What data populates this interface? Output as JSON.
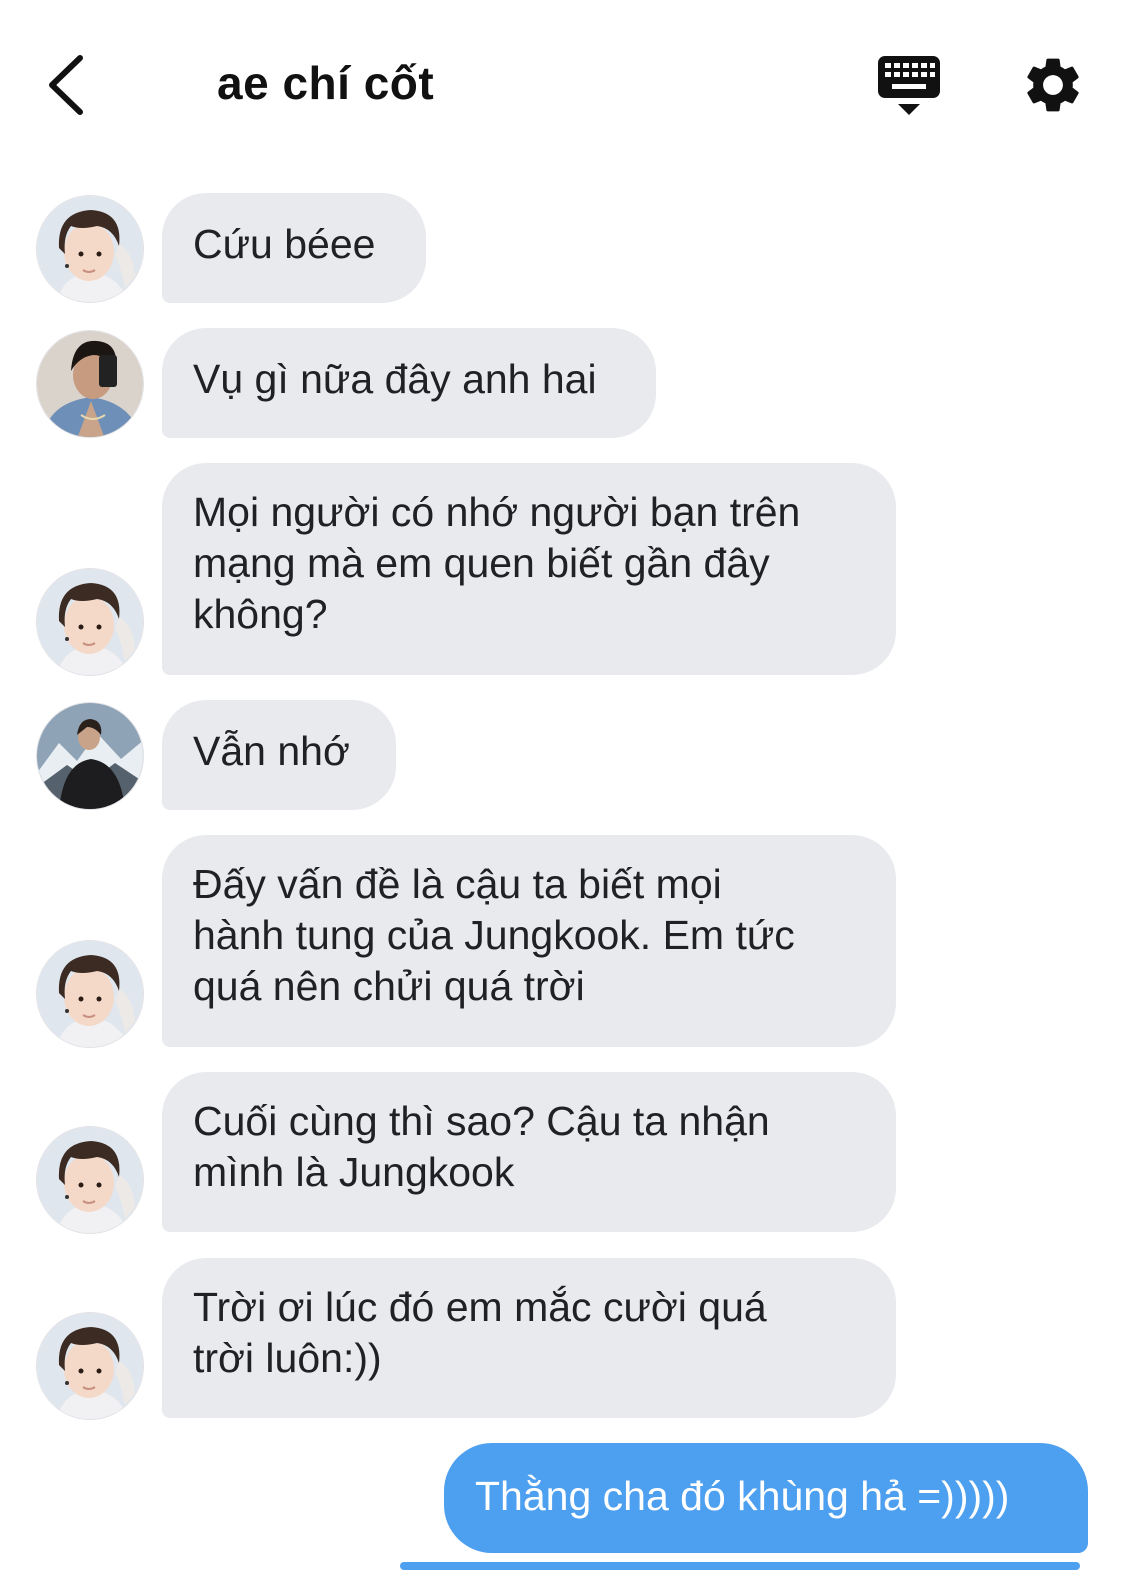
{
  "header": {
    "title": "ae chí cốt"
  },
  "icons": {
    "back": "chevron-left-icon",
    "keyboard": "keyboard-icon",
    "settings": "gear-icon"
  },
  "colors": {
    "incoming_bubble": "#e8eaee",
    "outgoing_bubble": "#4d9ff0",
    "outgoing_text": "#ffffff"
  },
  "messages": [
    {
      "sender": "jimin",
      "lines": [
        "Cứu béee"
      ]
    },
    {
      "sender": "taehyung",
      "lines": [
        "Vụ gì nữa đây anh hai"
      ]
    },
    {
      "sender": "jimin",
      "lines": [
        "Mọi người có nhớ người bạn trên",
        "mạng mà em quen biết gần đây",
        "không?"
      ]
    },
    {
      "sender": "jin",
      "lines": [
        "Vẫn nhớ"
      ]
    },
    {
      "sender": "jimin",
      "lines": [
        "Đấy vấn đề là cậu ta biết mọi",
        "hành tung của Jungkook. Em tức",
        "quá nên chửi quá trời"
      ]
    },
    {
      "sender": "jimin",
      "lines": [
        "Cuối cùng thì sao? Cậu ta nhận",
        "mình là Jungkook"
      ]
    },
    {
      "sender": "jimin",
      "lines": [
        "Trời ơi lúc đó em mắc cười quá",
        "trời luôn:))"
      ]
    }
  ],
  "own_message": {
    "text": "Thằng cha đó khùng hả =)))))"
  }
}
